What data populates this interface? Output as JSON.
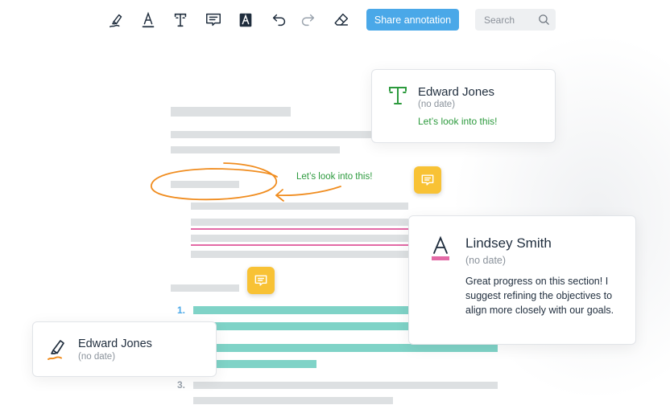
{
  "toolbar": {
    "tools": [
      {
        "icon": "highlighter-icon"
      },
      {
        "icon": "underline-text-icon"
      },
      {
        "icon": "text-box-icon"
      },
      {
        "icon": "comment-icon"
      },
      {
        "icon": "text-highlight-icon"
      },
      {
        "icon": "undo-icon"
      },
      {
        "icon": "redo-icon"
      },
      {
        "icon": "eraser-icon"
      }
    ],
    "share_label": "Share annotation",
    "search_placeholder": "Search",
    "accent_color": "#4aa8e8"
  },
  "document": {
    "list_numbers": [
      "1.",
      "3."
    ],
    "inline_note": "Let’s look into this!",
    "colors": {
      "highlight": "#7fd3c7",
      "underline": "#e36aa6",
      "circle": "#f08c1e",
      "note_button": "#f8c235",
      "note_text": "#2c9a3d"
    }
  },
  "cards": [
    {
      "icon": "text-box-icon",
      "author": "Edward Jones",
      "date": "(no date)",
      "text": "Let’s look into this!"
    },
    {
      "icon": "underline-text-icon",
      "author": "Lindsey Smith",
      "date": "(no date)",
      "text": "Great progress on this section! I suggest refining the objectives to align more closely with our goals."
    },
    {
      "icon": "highlighter-icon",
      "author": "Edward Jones",
      "date": "(no date)"
    }
  ]
}
